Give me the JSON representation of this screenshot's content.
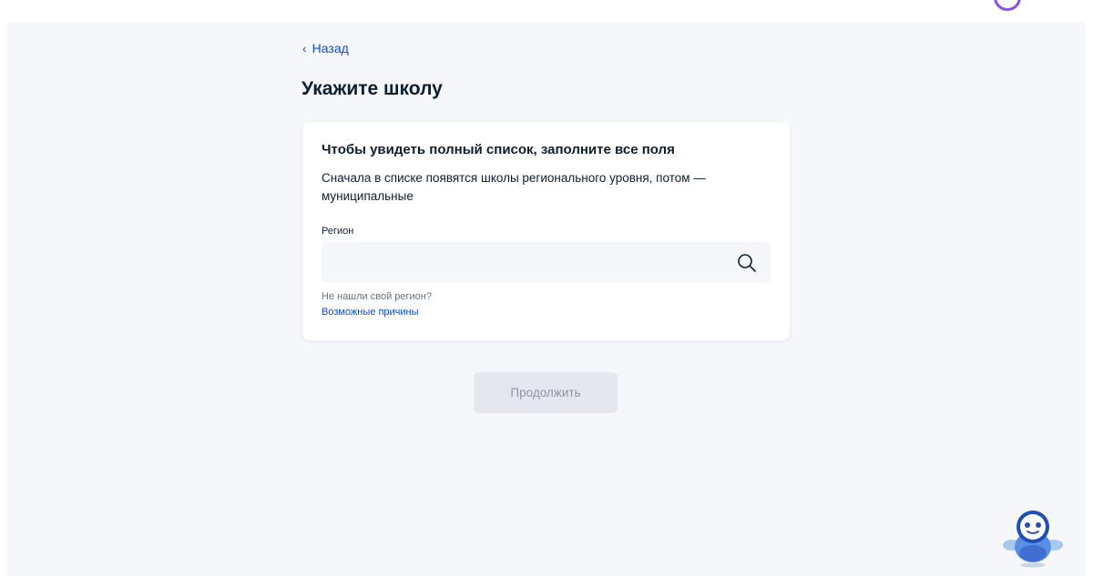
{
  "nav": {
    "back_label": "Назад"
  },
  "page": {
    "title": "Укажите школу"
  },
  "card": {
    "heading": "Чтобы увидеть полный список, заполните все поля",
    "description": "Сначала в списке появятся школы регионального уровня, потом — муниципальные",
    "region_field": {
      "label": "Регион",
      "value": "",
      "icon": "search-icon"
    },
    "hint": {
      "question": "Не нашли свой регион?",
      "link": "Возможные причины"
    }
  },
  "actions": {
    "continue_label": "Продолжить"
  },
  "colors": {
    "link": "#0d4cd3",
    "text": "#0b1f33",
    "page_background": "#f5f7fb",
    "button_disabled_bg": "#e4e8ee",
    "button_disabled_text": "#8d96a0"
  }
}
